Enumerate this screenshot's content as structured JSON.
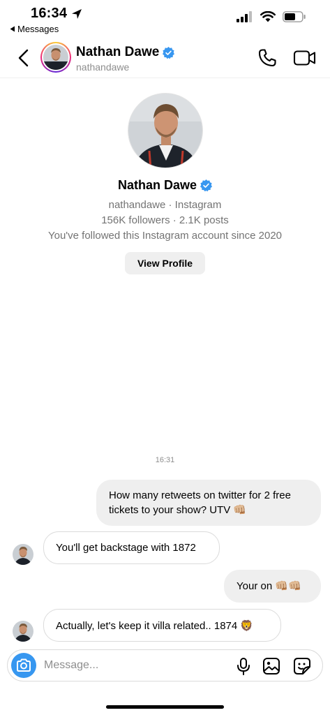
{
  "status_bar": {
    "time": "16:34",
    "back_label": "Messages"
  },
  "header": {
    "name": "Nathan Dawe",
    "username": "nathandawe"
  },
  "profile": {
    "name": "Nathan Dawe",
    "line1": "nathandawe · Instagram",
    "line2": "156K followers · 2.1K posts",
    "line3": "You've followed this Instagram account since 2020",
    "view_profile_label": "View Profile"
  },
  "conversation": {
    "timestamp": "16:31",
    "messages": [
      {
        "direction": "outgoing",
        "text": "How many retweets on twitter for 2 free tickets to your show? UTV 👊🏼"
      },
      {
        "direction": "incoming",
        "text": "You'll get backstage with 1872"
      },
      {
        "direction": "outgoing",
        "text": "Your on 👊🏼👊🏼"
      },
      {
        "direction": "incoming",
        "text": "Actually, let's keep it villa related.. 1874 🦁"
      }
    ]
  },
  "composer": {
    "placeholder": "Message..."
  },
  "colors": {
    "accent": "#3797f0",
    "verified": "#3897f0",
    "outgoing_bubble": "#efefef",
    "muted_text": "#737373"
  },
  "icons": [
    "location-arrow-icon",
    "signal-icon",
    "wifi-icon",
    "battery-icon",
    "back-chevron-icon",
    "verified-badge-icon",
    "phone-icon",
    "video-icon",
    "camera-icon",
    "microphone-icon",
    "image-icon",
    "sticker-icon"
  ]
}
